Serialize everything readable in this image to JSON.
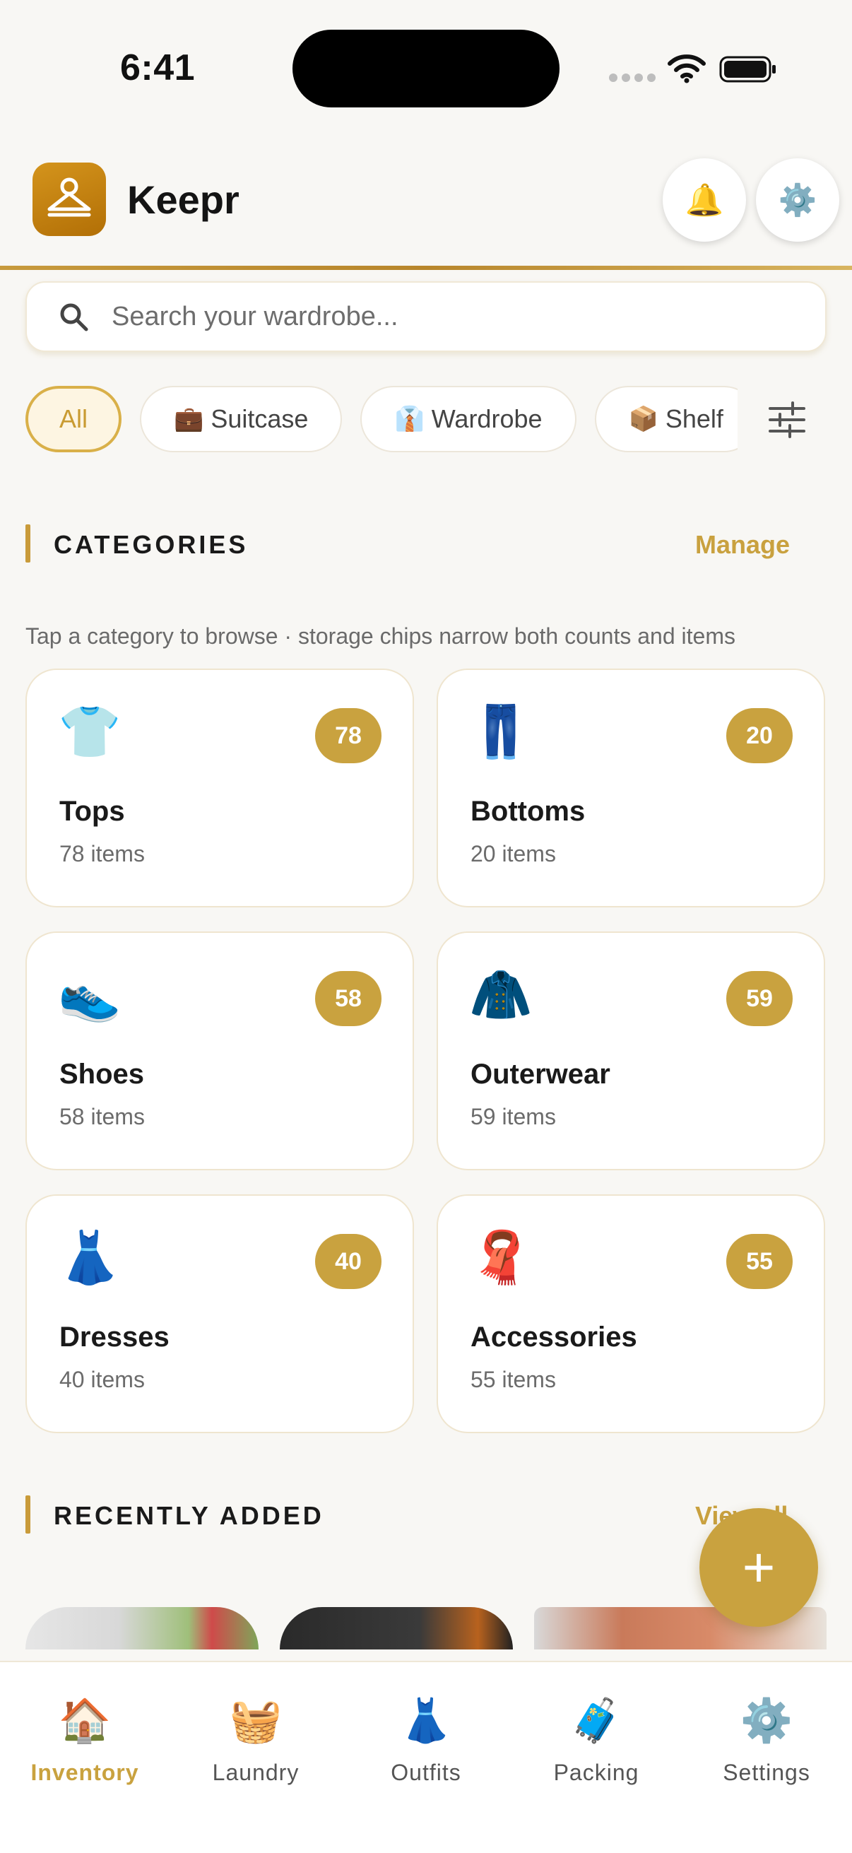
{
  "status_bar": {
    "time": "6:41"
  },
  "header": {
    "app_name": "Keepr",
    "bell_icon": "🔔",
    "settings_icon": "⚙️"
  },
  "search": {
    "placeholder": "Search your wardrobe..."
  },
  "storage_chips": [
    {
      "label": "All",
      "emoji": "",
      "active": true
    },
    {
      "label": "Suitcase",
      "emoji": "💼",
      "active": false
    },
    {
      "label": "Wardrobe",
      "emoji": "👔",
      "active": false
    },
    {
      "label": "Shelf",
      "emoji": "📦",
      "active": false
    }
  ],
  "categories_section": {
    "title": "CATEGORIES",
    "action": "Manage",
    "subtitle": "Tap a category to browse · storage chips narrow both counts and items"
  },
  "categories": [
    {
      "name": "Tops",
      "emoji": "👕",
      "badge": "78",
      "count": "78 items"
    },
    {
      "name": "Bottoms",
      "emoji": "👖",
      "badge": "20",
      "count": "20 items"
    },
    {
      "name": "Shoes",
      "emoji": "👟",
      "badge": "58",
      "count": "58 items"
    },
    {
      "name": "Outerwear",
      "emoji": "🧥",
      "badge": "59",
      "count": "59 items"
    },
    {
      "name": "Dresses",
      "emoji": "👗",
      "badge": "40",
      "count": "40 items"
    },
    {
      "name": "Accessories",
      "emoji": "🧣",
      "badge": "55",
      "count": "55 items"
    }
  ],
  "recent_section": {
    "title": "RECENTLY ADDED",
    "action": "View all"
  },
  "fab": {
    "label": "+"
  },
  "bottom_nav": [
    {
      "label": "Inventory",
      "emoji": "🏠",
      "active": true
    },
    {
      "label": "Laundry",
      "emoji": "🧺",
      "active": false
    },
    {
      "label": "Outfits",
      "emoji": "👗",
      "active": false
    },
    {
      "label": "Packing",
      "emoji": "🧳",
      "active": false
    },
    {
      "label": "Settings",
      "emoji": "⚙️",
      "active": false
    }
  ],
  "colors": {
    "accent": "#c9a23f",
    "background": "#f8f7f4",
    "logo": "#c8860f"
  }
}
